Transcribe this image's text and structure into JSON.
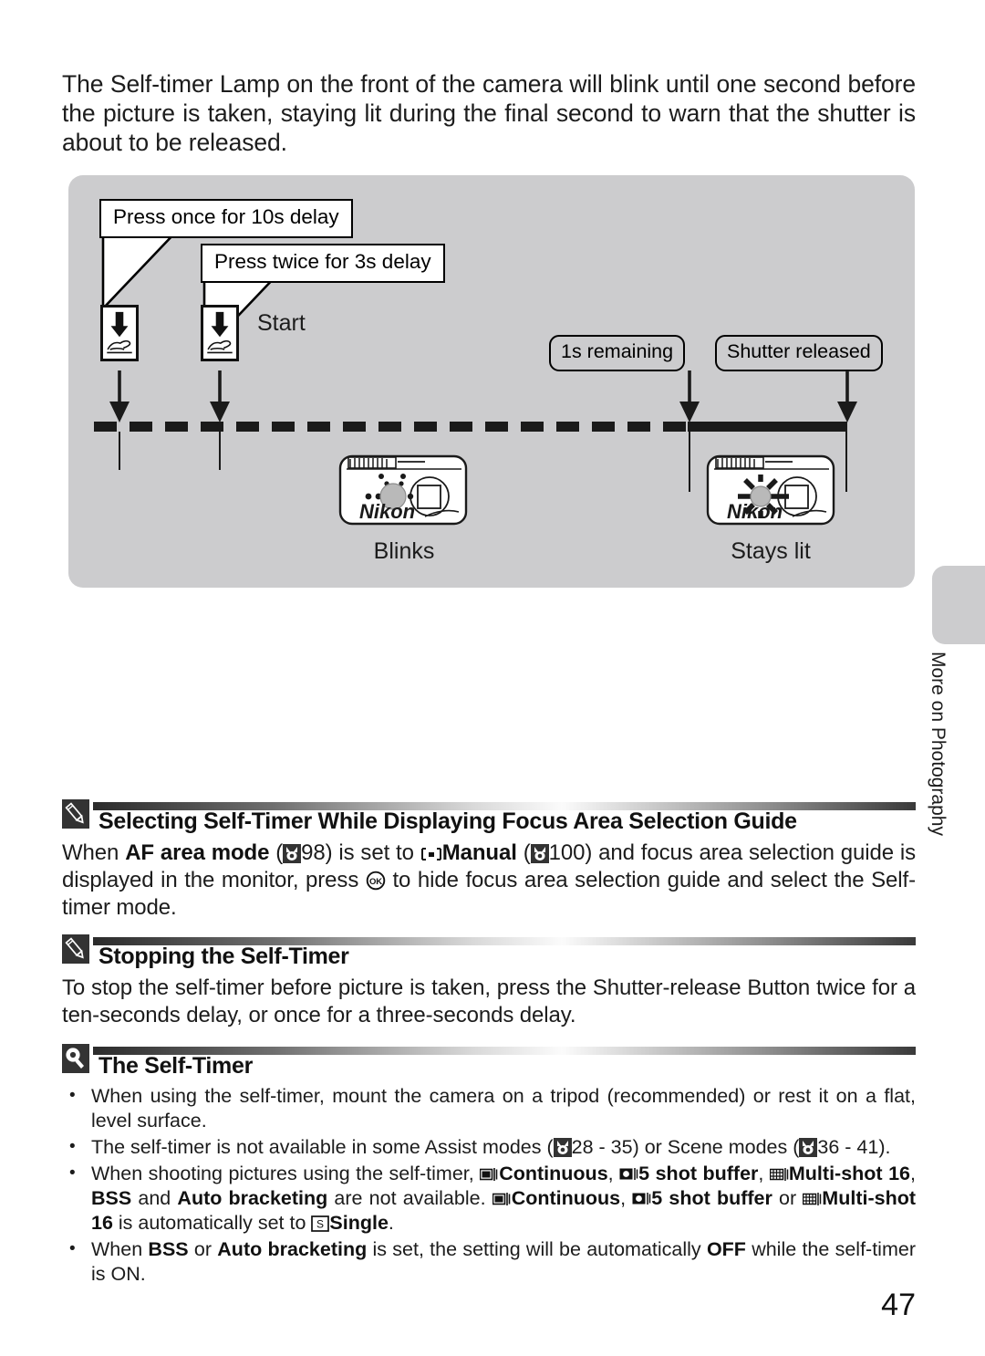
{
  "intro": {
    "text": "The Self-timer Lamp on the front of the camera will blink until one second before the picture is taken, staying lit during the final second to warn that the shutter is about to be released."
  },
  "diagram": {
    "background_color": "#ccccce",
    "callouts": [
      {
        "label": "Press once for 10s delay",
        "name": "callout-press-once"
      },
      {
        "label": "Press twice for 3s delay",
        "name": "callout-press-twice"
      }
    ],
    "start_label": "Start",
    "pills": [
      {
        "label": "1s remaining",
        "name": "pill-1s-remaining"
      },
      {
        "label": "Shutter released",
        "name": "pill-shutter-released"
      }
    ],
    "cameras": [
      {
        "caption": "Blinks",
        "logo": "Nikon",
        "state": "blinking"
      },
      {
        "caption": "Stays lit",
        "logo": "Nikon",
        "state": "lit"
      }
    ]
  },
  "side_tab": {
    "label": "More on Photography"
  },
  "notes": [
    {
      "icon": "pencil-icon",
      "title": "Selecting Self-Timer While Displaying Focus Area Selection Guide",
      "body_parts": {
        "p1": "When ",
        "b1": "AF area mode",
        "p2": " (",
        "ref1": "98",
        "p3": ") is set to ",
        "b2": "Manual",
        "p4": " (",
        "ref2": "100",
        "p5": ") and focus area selection guide is displayed in the monitor, press ",
        "p6": " to hide focus area selection guide and select the Self-timer mode."
      }
    },
    {
      "icon": "pencil-icon",
      "title": "Stopping the Self-Timer",
      "body": "To stop the self-timer before picture is taken, press the Shutter-release Button twice for a ten-seconds delay, or once for a three-seconds delay."
    },
    {
      "icon": "tip-bulb-icon",
      "title": "The Self-Timer",
      "bullets": {
        "b1": "When using the self-timer, mount the camera on a tripod (recommended) or rest it on a flat, level surface.",
        "b2_p1": "The self-timer is not available in some Assist modes (",
        "b2_ref1": "28 - 35",
        "b2_p2": ") or Scene modes (",
        "b2_ref2": "36 - 41",
        "b2_p3": ").",
        "b3_p1": "When shooting pictures using the self-timer, ",
        "b3_m1": "Continuous",
        "b3_p2": ", ",
        "b3_m2": "5 shot buffer",
        "b3_p3": ", ",
        "b3_m3": "Multi-shot 16",
        "b3_p4": ", ",
        "b3_m4": "BSS",
        "b3_p5": " and ",
        "b3_m5": "Auto bracketing",
        "b3_p6": " are not available. ",
        "b3_m6": "Continuous",
        "b3_p7": ", ",
        "b3_m7": "5 shot buffer",
        "b3_p8": " or ",
        "b3_m8": "Multi-shot 16",
        "b3_p9": " is automatically set to ",
        "b3_m9": "Single",
        "b3_p10": ".",
        "b4_p1": "When ",
        "b4_m1": "BSS",
        "b4_p2": " or ",
        "b4_m2": "Auto bracketing",
        "b4_p3": " is set, the setting will be automatically ",
        "b4_m3": "OFF",
        "b4_p4": " while the self-timer is ON."
      }
    }
  ],
  "page_number": "47"
}
